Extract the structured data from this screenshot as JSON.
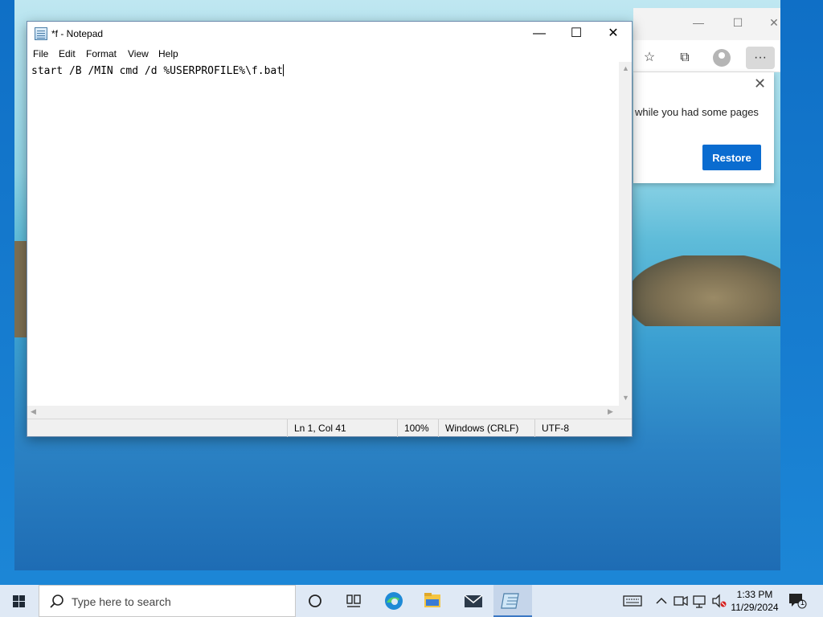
{
  "edge": {
    "restore_text": "while you had some pages",
    "restore_button": "Restore",
    "more_label": "···"
  },
  "notepad": {
    "title": "*f - Notepad",
    "menu": [
      "File",
      "Edit",
      "Format",
      "View",
      "Help"
    ],
    "content": "start /B /MIN cmd /d %USERPROFILE%\\f.bat",
    "status": {
      "position": "Ln 1, Col 41",
      "zoom": "100%",
      "line_ending": "Windows (CRLF)",
      "encoding": "UTF-8"
    }
  },
  "taskbar": {
    "search_placeholder": "Type here to search",
    "time": "1:33 PM",
    "date": "11/29/2024",
    "notification_count": "1"
  },
  "colors": {
    "accent": "#0a6cd0",
    "taskbar": "#dfe9f5"
  }
}
